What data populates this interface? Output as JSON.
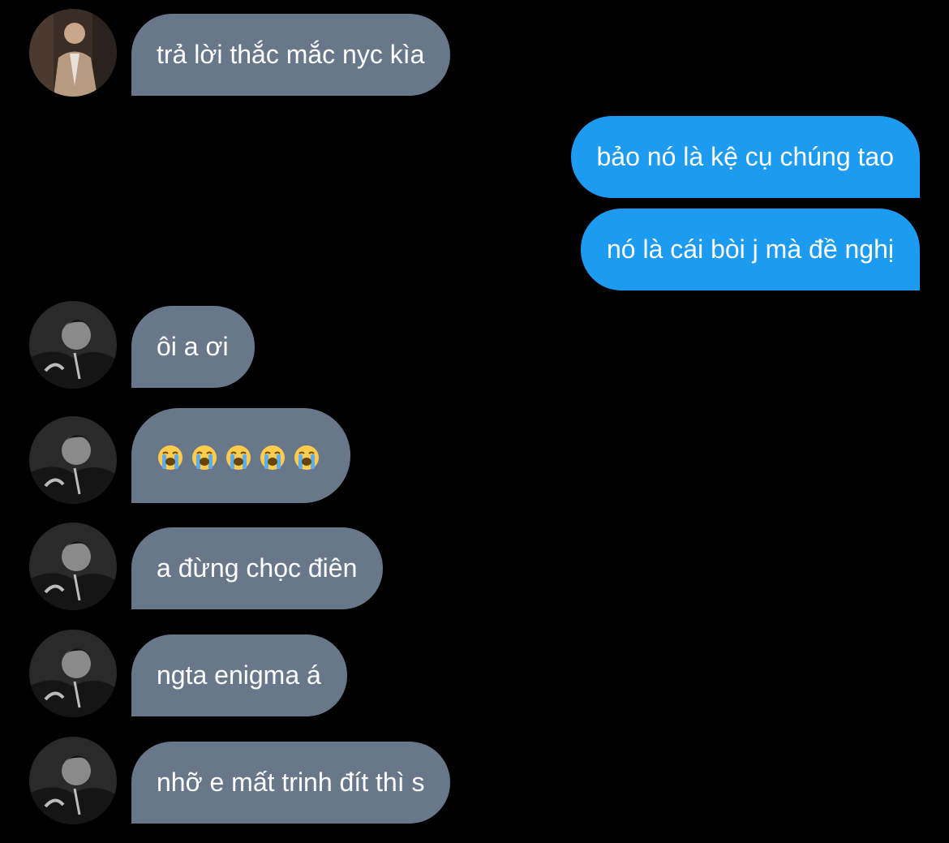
{
  "conversation": {
    "messages": [
      {
        "side": "incoming",
        "text": "trả lời thắc mắc nyc kìa"
      },
      {
        "side": "outgoing",
        "text": "bảo nó là kệ cụ chúng tao"
      },
      {
        "side": "outgoing",
        "text": "nó là cái bòi j mà đề nghị"
      },
      {
        "side": "incoming",
        "text": "ôi a ơi"
      },
      {
        "side": "incoming",
        "emoji": [
          "loudly-crying-face",
          "loudly-crying-face",
          "loudly-crying-face",
          "loudly-crying-face",
          "loudly-crying-face"
        ]
      },
      {
        "side": "incoming",
        "text": "a đừng chọc điên"
      },
      {
        "side": "incoming",
        "text": "ngta enigma á"
      },
      {
        "side": "incoming",
        "text": "nhỡ e mất trinh đít thì s"
      }
    ]
  },
  "colors": {
    "background": "#000000",
    "incoming_bubble": "#68788a",
    "outgoing_bubble": "#1d9bf0",
    "text": "#ffffff"
  },
  "icons": {
    "avatar_1": "avatar-man-in-suit-photo",
    "avatar_2": "avatar-man-dark-hair-photo"
  }
}
